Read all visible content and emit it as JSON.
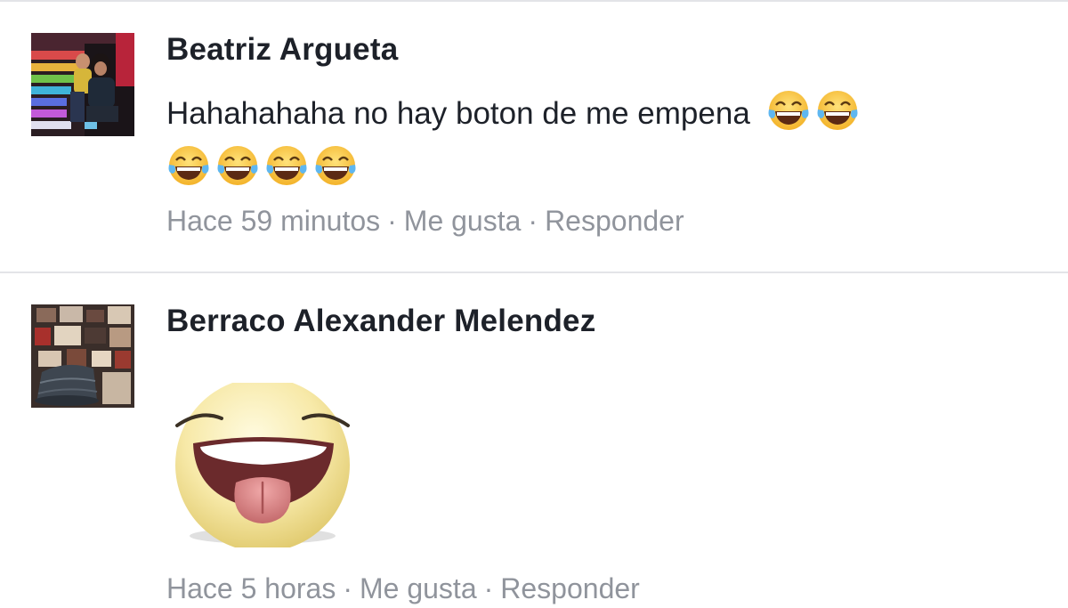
{
  "comments": [
    {
      "author": "Beatriz Argueta",
      "text": "Hahahahaha no hay boton de me empena",
      "emoji_icon": "face-with-tears-of-joy-emoji",
      "time": "Hace 59 minutos",
      "separator": "·",
      "like_label": "Me gusta",
      "reply_label": "Responder"
    },
    {
      "author": "Berraco Alexander Melendez",
      "sticker_icon": "laughing-face-tongue-out-sticker",
      "time": "Hace 5 horas",
      "separator": "·",
      "like_label": "Me gusta",
      "reply_label": "Responder"
    }
  ],
  "colors": {
    "author_text": "#1d2129",
    "meta_text": "#90949c",
    "divider": "#e3e4e8"
  }
}
